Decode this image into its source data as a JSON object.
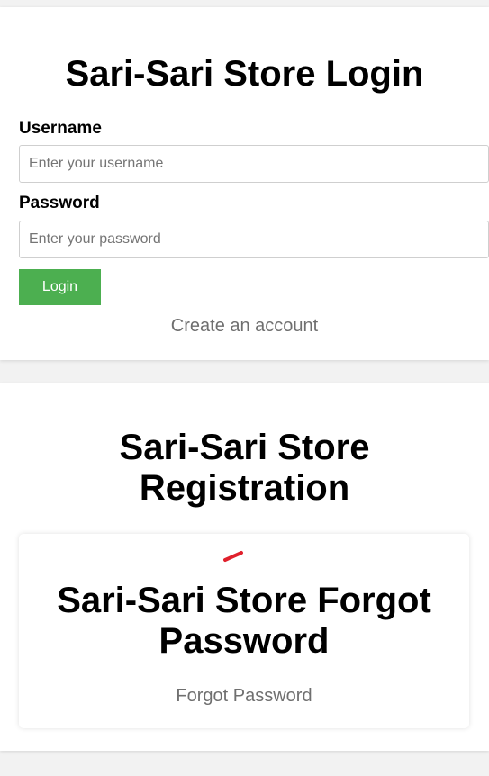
{
  "login": {
    "title": "Sari-Sari Store Login",
    "username_label": "Username",
    "username_placeholder": "Enter your username",
    "password_label": "Password",
    "password_placeholder": "Enter your password",
    "login_button": "Login",
    "create_account_link": "Create an account"
  },
  "registration": {
    "title_line1": "Sari-Sari Store",
    "title_line2": "Registration"
  },
  "forgot": {
    "title_line1": "Sari-Sari Store Forgot",
    "title_line2": "Password",
    "link": "Forgot Password",
    "mark_color": "#e0202c"
  },
  "colors": {
    "button_bg": "#4caf50",
    "link_text": "#6f6f6f"
  }
}
